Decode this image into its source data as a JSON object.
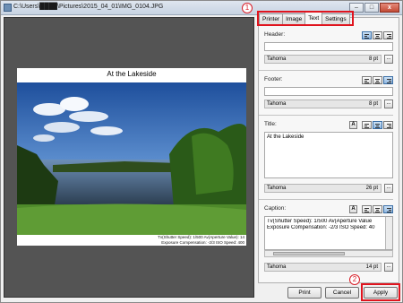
{
  "window": {
    "title": "C:\\Users\\████\\Pictures\\2015_04_01\\IMG_0104.JPG",
    "buttons": {
      "minimize": "–",
      "maximize": "□",
      "close": "x"
    }
  },
  "preview": {
    "title": "At the Lakeside",
    "caption_line1": "Tv(Shutter Speed): 1/500 Av(Aperture Value): 14",
    "caption_line2": "Exposure Compensation: -2/3 ISO Speed: 400"
  },
  "tabs": [
    {
      "label": "Printer"
    },
    {
      "label": "Image"
    },
    {
      "label": "Text"
    },
    {
      "label": "Settings"
    }
  ],
  "callouts": {
    "one": "1",
    "two": "2"
  },
  "sections": {
    "header": {
      "label": "Header:",
      "value": "",
      "font": "Tahoma",
      "size": "8 pt"
    },
    "footer": {
      "label": "Footer:",
      "value": "",
      "font": "Tahoma",
      "size": "8 pt"
    },
    "title": {
      "label": "Title:",
      "value": "At the Lakeside",
      "font": "Tahoma",
      "size": "26 pt"
    },
    "caption": {
      "label": "Caption:",
      "line1": "Tv(Shutter Speed): 1/500 Av(Aperture Value",
      "line2": "Exposure Compensation: -2/3 ISO Speed: 40",
      "font": "Tahoma",
      "size": "14 pt"
    }
  },
  "dots_label": "...",
  "bold_label": "A",
  "footer_buttons": {
    "print": "Print",
    "cancel": "Cancel",
    "apply": "Apply"
  },
  "colors": {
    "highlight": "#e0141e",
    "preview_bg": "#545454"
  }
}
